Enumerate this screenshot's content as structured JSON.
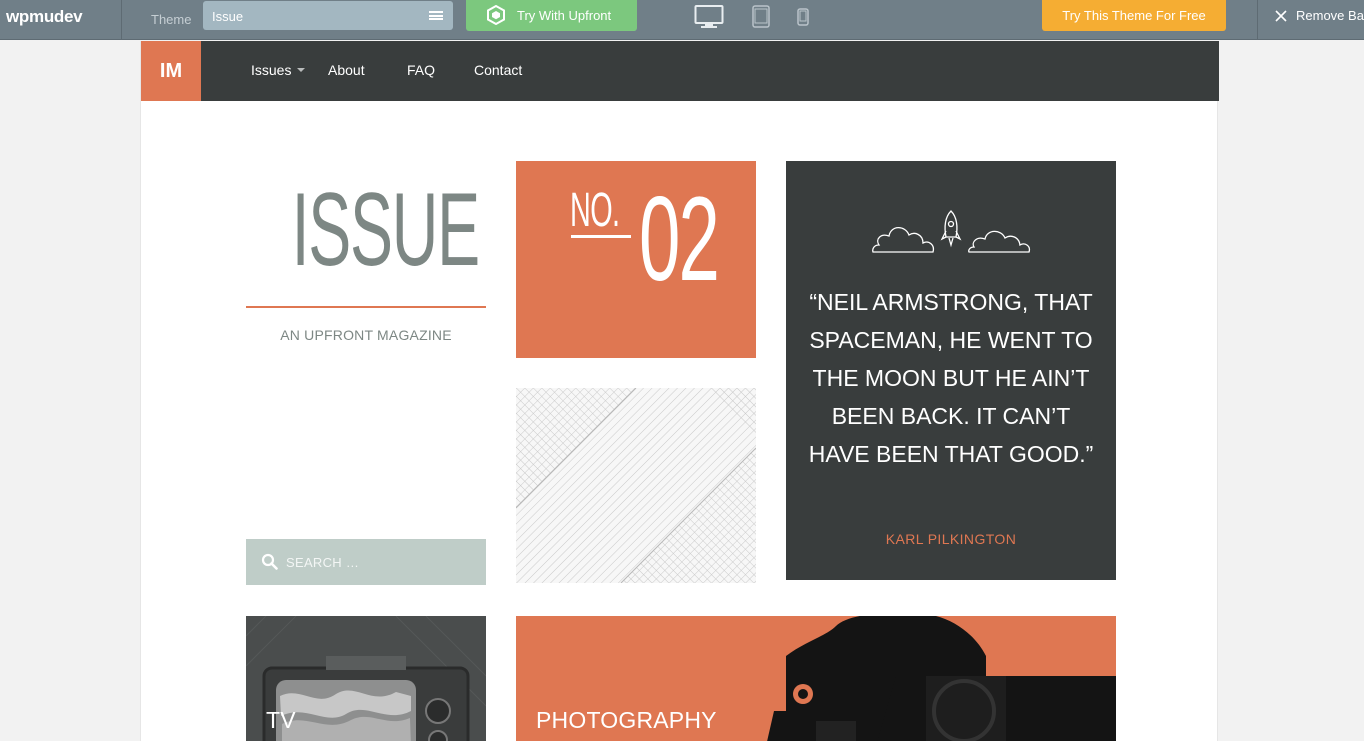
{
  "topbar": {
    "brand": "wpmudev",
    "theme_label": "Theme",
    "theme_value": "Issue",
    "try_upfront_label": "Try With Upfront",
    "devices": [
      "desktop-icon",
      "tablet-icon",
      "mobile-icon"
    ],
    "try_free_label": "Try This Theme For Free",
    "remove_bar_label": "Remove Ba"
  },
  "site": {
    "logo": "IM",
    "nav": [
      "Issues",
      "About",
      "FAQ",
      "Contact"
    ],
    "masthead": {
      "title": "ISSUE",
      "subtitle": "AN UPFRONT MAGAZINE"
    },
    "issue_number": {
      "prefix": "NO.",
      "number": "02"
    },
    "quote": {
      "text": "“NEIL ARMSTRONG, THAT SPACEMAN, HE WENT TO THE MOON BUT HE AIN’T BEEN BACK. IT CAN’T HAVE BEEN THAT GOOD.”",
      "author": "KARL PILKINGTON"
    },
    "search": {
      "placeholder": "SEARCH …"
    },
    "tiles": [
      {
        "label": "TV"
      },
      {
        "label": "PHOTOGRAPHY"
      }
    ]
  },
  "colors": {
    "accent": "#df7752",
    "dark": "#393d3d",
    "topbar": "#707f88",
    "upfront_green": "#7cc87e",
    "cta_orange": "#f5ad33",
    "search_bg": "#bfcdc8"
  }
}
